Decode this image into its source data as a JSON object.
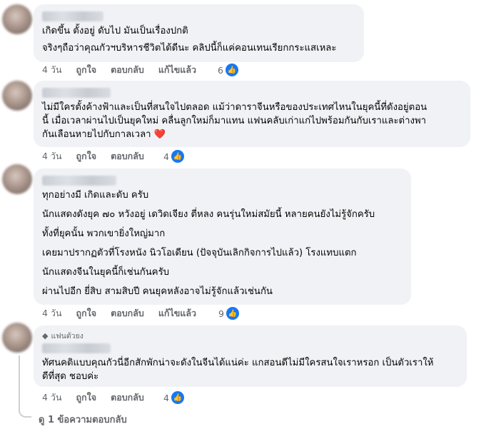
{
  "comments": [
    {
      "lines": [
        [
          "เกิดขึ้น ตั้งอยู่ ดับไป มันเป็นเรื่องปกติ"
        ],
        [
          "จริงๆถือว่าคุณกัวฯบริหารชีวิตได้ดีนะ คลิปนี้ก็แค่คอนเทนเรียกกระแสเหละ"
        ]
      ],
      "time": "4 วัน",
      "like": "ถูกใจ",
      "reply": "ตอบกลับ",
      "edited": "แก้ไขแล้ว",
      "reactions": "6"
    },
    {
      "lines": [
        [
          "ไม่มีใครตั้งค้างฟ้าและเป็นที่สนใจไปตลอด แม้ว่าดาราจีนหรือของประเทศไหนในยุคนี้ที่ดังอยู่ตอน",
          "นี้ เมื่อเวลาผ่านไปเป็นยุคใหม่ คลื่นลูกใหม่ก็มาแทน แฟนคลับเก่าแก่ไปพร้อมกันกับเราและต่างพา",
          "กันเลือนหายไปกับกาลเวลา ❤️"
        ]
      ],
      "time": "4 วัน",
      "like": "ถูกใจ",
      "reply": "ตอบกลับ",
      "reactions": "4"
    },
    {
      "lines": [
        [
          "ทุกอย่างมี เกิดและดับ ครับ"
        ],
        [
          "นักแสดงดังยุค ๗๐ หวังอยู่ เดวิดเจียง ตี่หลง คนรุ่นใหม่สมัยนี้ หลายคนยังไม่รู้จักครับ"
        ],
        [
          "ทั้งที่ยุคนั้น พวกเขายิ่งใหญ่มาก"
        ],
        [
          "เคยมาปรากฏตัวที่โรงหนัง นิวโอเดียน (ปัจจุบันเลิกกิจการไปแล้ว) โรงแทบแตก"
        ],
        [
          "นักแสดงจีนในยุคนี้ก็เช่นกันครับ"
        ],
        [
          "ผ่านไปอีก ยี่สิบ สามสิบปี คนยุคหลังอาจไม่รู้จักแล้วเช่นกัน"
        ]
      ],
      "time": "4 วัน",
      "like": "ถูกใจ",
      "reply": "ตอบกลับ",
      "edited": "แก้ไขแล้ว",
      "reactions": "9"
    },
    {
      "badge": "แฟนตัวยง",
      "lines": [
        [
          "ทัศนคติแบบคุณกัวนี่อีกสักพักน่าจะดังในจีนได้แน่ค่ะ แกสอนดีไม่มีใครสนใจเราหรอก เป็นตัวเราให้",
          "ดีที่สุด ชอบค่ะ"
        ]
      ],
      "time": "4 วัน",
      "like": "ถูกใจ",
      "reply": "ตอบกลับ",
      "reactions": "4"
    }
  ],
  "view_replies": "ดู 1 ข้อความตอบกลับ",
  "icons": {
    "like": "thumbs-up-icon",
    "badge": "diamond-icon"
  },
  "colors": {
    "bubble": "#f0f2f5",
    "like_badge": "#1877f2",
    "meta": "#65676b"
  }
}
